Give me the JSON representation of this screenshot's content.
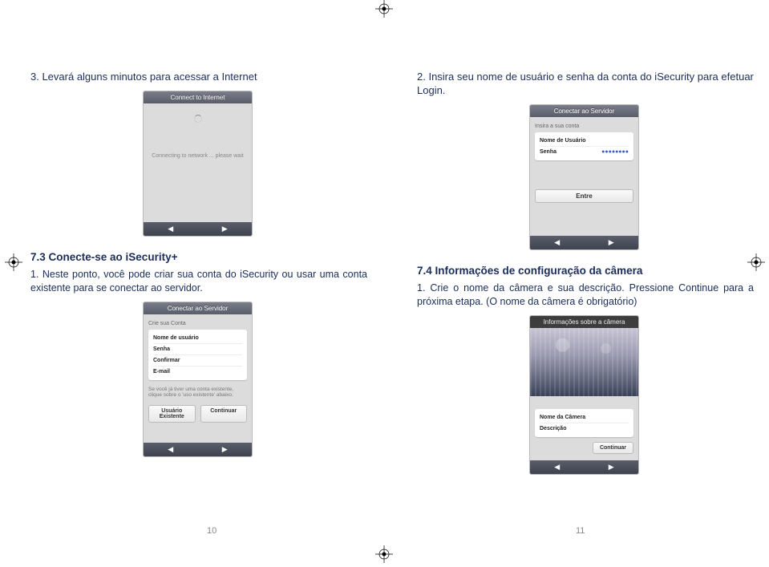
{
  "left": {
    "step3_text": "3. Levará alguns minutos para acessar a Internet",
    "connect_header": "Connect to Internet",
    "connect_loading": "Connecting to network ... please wait",
    "section73": "7.3 Conecte-se ao iSecurity+",
    "body73": "1. Neste ponto, você pode criar sua conta do iSecurity ou usar uma conta existente para se conectar ao servidor.",
    "create_header": "Conectar ao Servidor",
    "create_hint": "Crie sua Conta",
    "field_user": "Nome de usuário",
    "field_pass": "Senha",
    "field_confirm": "Confirmar",
    "field_email": "E-mail",
    "small_hint": "Se você já tiver uma conta existente, clique sobre o 'uso existente' abaixo.",
    "btn_existing": "Usuário Existente",
    "btn_continue": "Continuar",
    "page_num": "10"
  },
  "right": {
    "step2_text": "2. Insira seu nome de usuário e senha da conta do iSecurity para efetuar Login.",
    "login_header": "Conectar ao Servidor",
    "login_hint": "Insira a sua conta",
    "login_user": "Nome de Usuário",
    "login_pass": "Senha",
    "login_pass_mask": "●●●●●●●●",
    "btn_enter": "Entre",
    "section74": "7.4 Informações de configuração da câmera",
    "body74": "1. Crie o nome da câmera e sua descrição. Pressione Continue para a próxima etapa. (O nome da câmera é obrigatório)",
    "cam_header": "Informações sobre a câmera",
    "cam_name": "Nome da Câmera",
    "cam_desc": "Descrição",
    "cam_continue": "Continuar",
    "page_num": "11"
  },
  "nav": {
    "prev": "◀",
    "next": "▶"
  }
}
